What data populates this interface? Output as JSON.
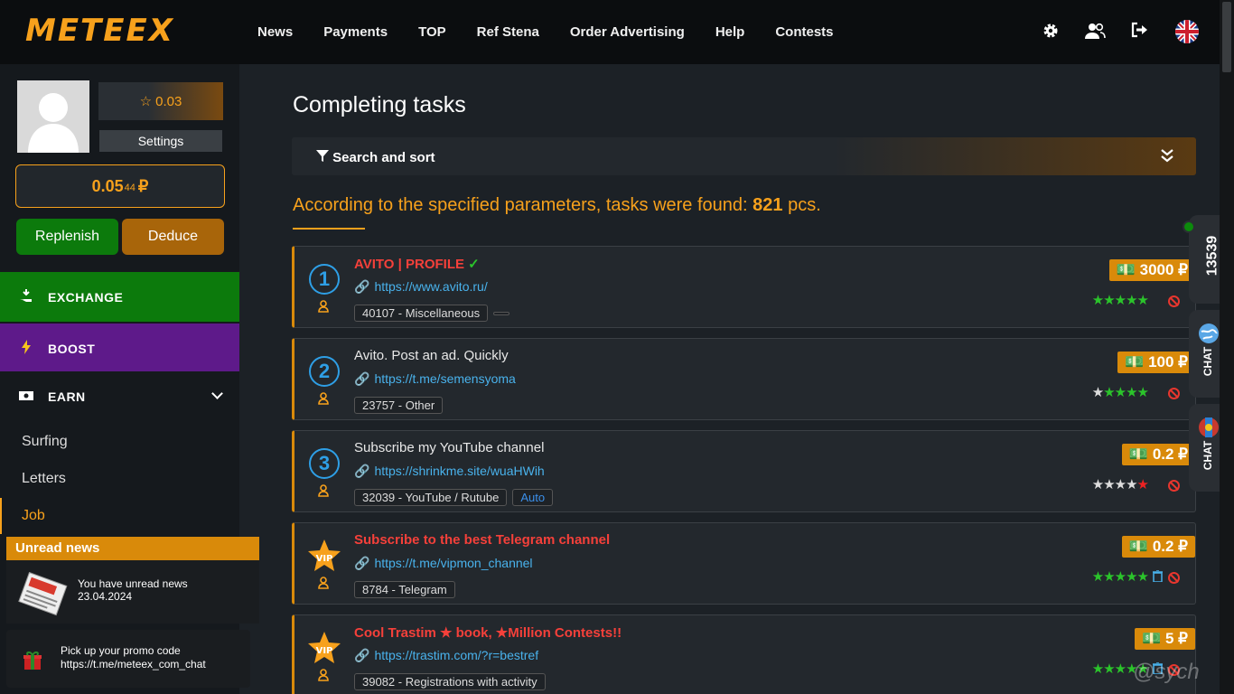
{
  "header": {
    "logo": "METEEX",
    "nav": [
      "News",
      "Payments",
      "TOP",
      "Ref Stena",
      "Order Advertising",
      "Help",
      "Contests"
    ],
    "icons": [
      "gear-icon",
      "users-icon",
      "logout-icon",
      "uk-flag-icon"
    ]
  },
  "profile": {
    "rating": "0.03",
    "settings_label": "Settings",
    "balance_main": "0.05",
    "balance_sub": "44",
    "currency": "₽",
    "replenish_label": "Replenish",
    "deduce_label": "Deduce"
  },
  "sidebar": {
    "exchange": "EXCHANGE",
    "boost": "BOOST",
    "earn": "EARN",
    "items": [
      {
        "label": "Surfing"
      },
      {
        "label": "Letters"
      },
      {
        "label": "Job"
      }
    ]
  },
  "news_widget": {
    "title": "Unread news",
    "text": "You have unread news",
    "date": "23.04.2024"
  },
  "promo": {
    "line1": "Pick up your promo code",
    "line2": "https://t.me/meteex_com_chat"
  },
  "main": {
    "title": "Completing tasks",
    "search_label": "Search and sort",
    "found_prefix": "According to the specified parameters, tasks were found:",
    "found_count": "821",
    "found_suffix": "pcs."
  },
  "tasks": [
    {
      "badge": "1",
      "title": "AVITO | PROFILE",
      "url": "https://www.avito.ru/",
      "category": "40107 - Miscellaneous",
      "price": "3000 ₽",
      "stars": 5
    },
    {
      "badge": "2",
      "title": "Avito. Post an ad. Quickly",
      "url": "https://t.me/semensyoma",
      "category": "23757 - Other",
      "price": "100 ₽",
      "stars": 4
    },
    {
      "badge": "3",
      "title": "Subscribe my YouTube channel",
      "url": "https://shrinkme.site/wuaHWih",
      "category": "32039 - YouTube / Rutube",
      "extra_tag": "Auto",
      "price": "0.2 ₽",
      "stars": 0
    },
    {
      "badge": "VIP",
      "title": "Subscribe to the best Telegram channel",
      "url": "https://t.me/vipmon_channel",
      "category": "8784 - Telegram",
      "price": "0.2 ₽",
      "stars": 5
    },
    {
      "badge": "VIP",
      "title": "Cool Trastim ★ book, ★Million Contests!!",
      "url": "https://trastim.com/?r=bestref",
      "category": "39082 - Registrations with activity",
      "price": "5 ₽",
      "stars": 5
    }
  ],
  "side_tabs": {
    "count": "13539",
    "chat1": "CHAT",
    "chat2": "CHAT"
  },
  "watermark": "@sych",
  "colors": {
    "accent": "#f7a11c",
    "exchange": "#0c7a0c",
    "boost": "#5e1a8a",
    "link": "#49b2ec",
    "vip_title": "#f5403a"
  }
}
